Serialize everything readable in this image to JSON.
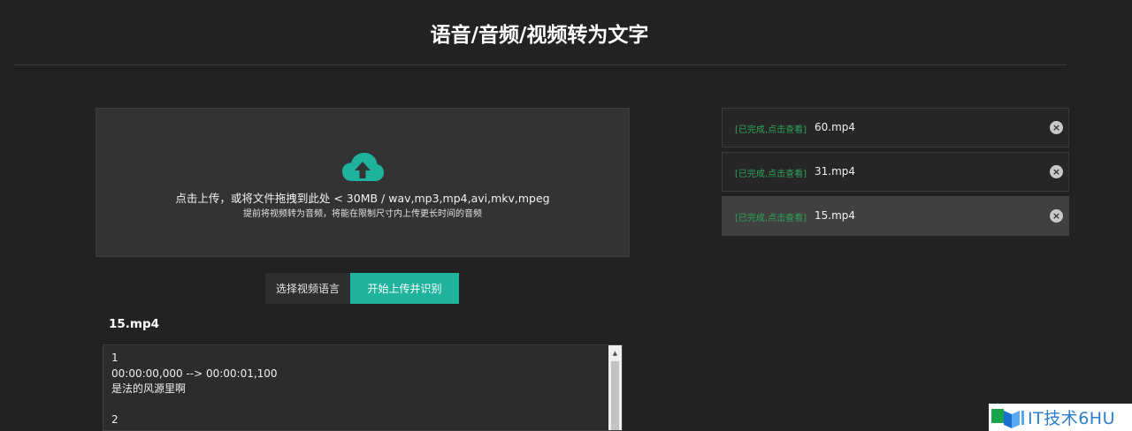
{
  "page": {
    "title": "语音/音频/视频转为文字"
  },
  "upload": {
    "icon": "cloud-upload-icon",
    "instruction": "点击上传，或将文件拖拽到此处 < 30MB / wav,mp3,mp4,avi,mkv,mpeg",
    "hint": "提前将视频转为音频，将能在限制尺寸内上传更长时间的音频"
  },
  "actions": {
    "language_label": "选择视频语言",
    "start_label": "开始上传并识别"
  },
  "result": {
    "file_name": "15.mp4",
    "transcript": "1\n00:00:00,000 --> 00:00:01,100\n是法的风源里啊\n\n2"
  },
  "file_list": {
    "items": [
      {
        "status": "[已完成,点击查看]",
        "name": "60.mp4",
        "selected": false
      },
      {
        "status": "[已完成,点击查看]",
        "name": "31.mp4",
        "selected": false
      },
      {
        "status": "[已完成,点击查看]",
        "name": "15.mp4",
        "selected": true
      }
    ],
    "close_icon": "close-circle-icon"
  },
  "watermark": {
    "text": "IT技术6HU"
  },
  "colors": {
    "accent": "#1fb39e",
    "status_green": "#2ea35a",
    "background": "#222222"
  }
}
